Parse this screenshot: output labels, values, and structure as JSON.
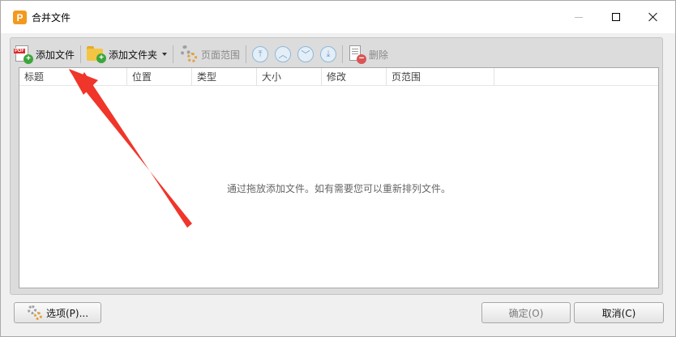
{
  "window": {
    "title": "合并文件",
    "app_icon_letter": "P"
  },
  "toolbar": {
    "add_file_label": "添加文件",
    "add_folder_label": "添加文件夹",
    "page_range_label": "页面范围",
    "delete_label": "删除"
  },
  "list": {
    "columns": [
      "标题",
      "位置",
      "类型",
      "大小",
      "修改",
      "页范围"
    ],
    "empty_hint": "通过拖放添加文件。如有需要您可以重新排列文件。"
  },
  "footer": {
    "options_label": "选项(P)...",
    "ok_label": "确定(O)",
    "cancel_label": "取消(C)"
  },
  "colors": {
    "annotation_arrow": "#f0352a",
    "app_icon": "#f39a1e"
  }
}
